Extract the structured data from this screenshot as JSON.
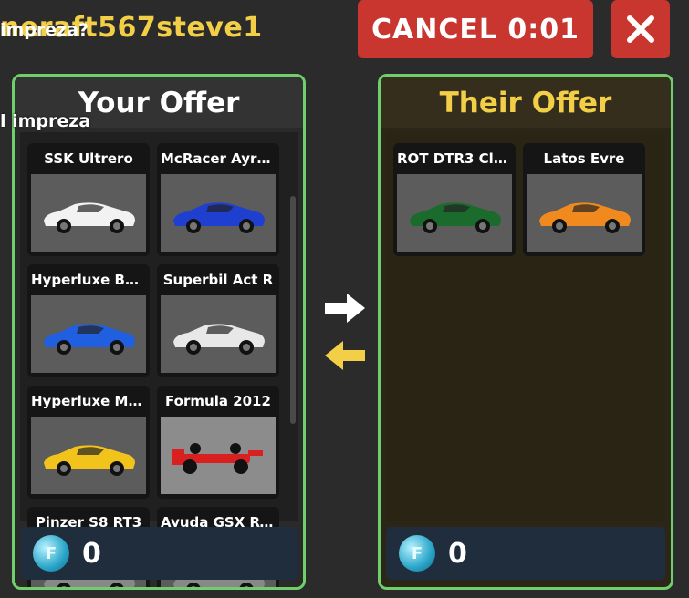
{
  "header": {
    "trade_partner": "neraft567steve1",
    "cancel_label": "CANCEL 0:01"
  },
  "chat": {
    "line1": "impreza?",
    "line2": "l impreza"
  },
  "your_offer": {
    "title": "Your Offer",
    "cars": [
      {
        "name": "SSK Ultrero",
        "color": "#f2f2f2"
      },
      {
        "name": "McRacer Ayrt...",
        "color": "#1f3fd0"
      },
      {
        "name": "Hyperluxe Balle",
        "color": "#1f5fe0"
      },
      {
        "name": "Superbil Act R",
        "color": "#e8e8e8"
      },
      {
        "name": "Hyperluxe Min...",
        "color": "#f2c31b"
      },
      {
        "name": "Formula 2012",
        "color": "#d92020"
      },
      {
        "name": "Pinzer S8 RT3",
        "color": "#888888"
      },
      {
        "name": "Ayuda GSX RT3",
        "color": "#888888"
      }
    ],
    "coins": "0"
  },
  "their_offer": {
    "title": "Their Offer",
    "cars": [
      {
        "name": "ROT DTR3 Club",
        "color": "#1b6b2c"
      },
      {
        "name": "Latos Evre",
        "color": "#f08a1e"
      }
    ],
    "coins": "0"
  },
  "colors": {
    "panel_border": "#6fcf6a",
    "cancel_bg": "#c9362f",
    "title_yellow": "#f3cf47",
    "coin_bar": "#1f2d3c"
  }
}
